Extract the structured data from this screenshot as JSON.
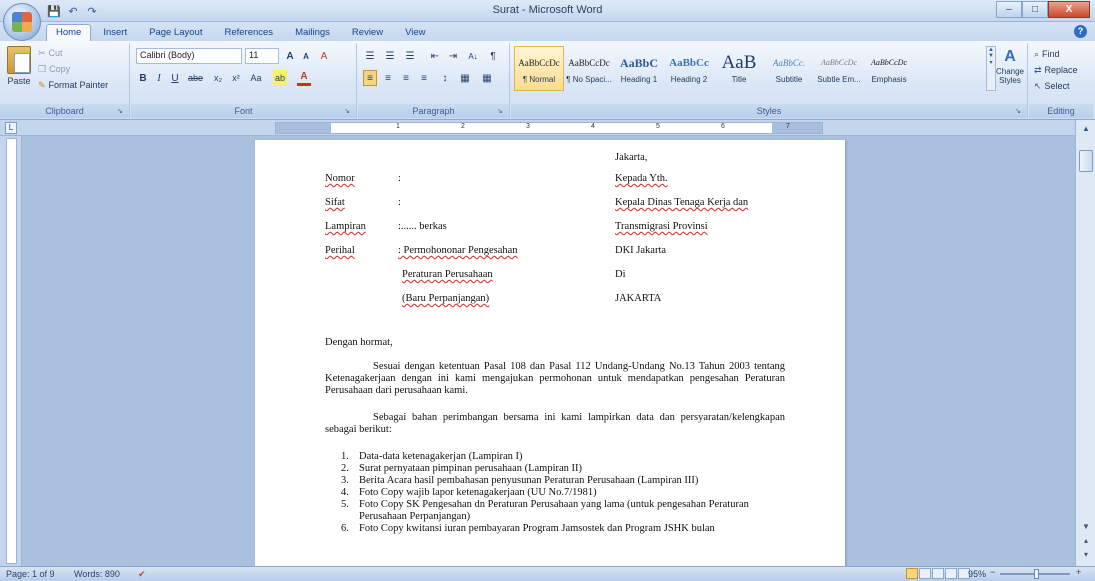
{
  "window": {
    "title": "Surat - Microsoft Word",
    "minimize": "–",
    "maximize": "□",
    "close": "X"
  },
  "qat": {
    "save": "💾",
    "undo": "↶",
    "redo": "↷"
  },
  "tabs": [
    "Home",
    "Insert",
    "Page Layout",
    "References",
    "Mailings",
    "Review",
    "View"
  ],
  "help": "?",
  "ribbon": {
    "clipboard": {
      "paste": "Paste",
      "cut": "Cut",
      "copy": "Copy",
      "format_painter": "Format Painter",
      "label": "Clipboard"
    },
    "font": {
      "name": "Calibri (Body)",
      "size": "11",
      "label": "Font",
      "grow": "A",
      "shrink": "A",
      "clear": "A",
      "bold": "B",
      "italic": "I",
      "underline": "U",
      "strike": "abe",
      "subscript": "x₂",
      "superscript": "x²",
      "change_case": "Aa",
      "highlight": "ab",
      "color": "A"
    },
    "paragraph": {
      "label": "Paragraph",
      "bullets": "☰",
      "numbering": "☰",
      "multilevel": "☰",
      "decrease_indent": "⇤",
      "increase_indent": "⇥",
      "sort": "A↓",
      "pilcrow": "¶",
      "align_left": "≡",
      "center": "≡",
      "align_right": "≡",
      "justify": "≡",
      "line_spacing": "↕",
      "shading": "▦",
      "borders": "▦"
    },
    "styles": {
      "label": "Styles",
      "items": [
        {
          "sample": "AaBbCcDc",
          "name": "¶ Normal"
        },
        {
          "sample": "AaBbCcDc",
          "name": "¶ No Spaci..."
        },
        {
          "sample": "AaBbC",
          "name": "Heading 1"
        },
        {
          "sample": "AaBbCc",
          "name": "Heading 2"
        },
        {
          "sample": "AaB",
          "name": "Title"
        },
        {
          "sample": "AaBbCc.",
          "name": "Subtitle"
        },
        {
          "sample": "AaBbCcDc",
          "name": "Subtle Em..."
        },
        {
          "sample": "AaBbCcDc",
          "name": "Emphasis"
        }
      ],
      "change_styles": "Change Styles"
    },
    "editing": {
      "label": "Editing",
      "find": "Find",
      "replace": "Replace",
      "select": "Select"
    }
  },
  "ruler": {
    "numbers": [
      "1",
      "2",
      "3",
      "4",
      "5",
      "6",
      "7"
    ]
  },
  "document": {
    "place": "Jakarta,",
    "header": [
      {
        "label": "Nomor",
        "colon": ":",
        "value": "",
        "right": "Kepada Yth."
      },
      {
        "label": "Sifat",
        "colon": ":",
        "value": "",
        "right": "Kepala Dinas Tenaga Kerja dan"
      },
      {
        "label": "Lampiran",
        "colon": "",
        "value": ":...... berkas",
        "right": "Transmigrasi Provinsi"
      },
      {
        "label": "Perihal",
        "colon": "",
        "value": ": Permohononar Pengesahan",
        "right": "DKI Jakarta"
      },
      {
        "label": "",
        "colon": "",
        "value": "Peraturan Perusahaan",
        "right": "Di"
      },
      {
        "label": "",
        "colon": "",
        "value": "(Baru Perpanjangan)",
        "right": "JAKARTA"
      }
    ],
    "greeting": "Dengan hormat,",
    "paragraph1": "Sesuai dengan ketentuan Pasal 108 dan Pasal 112 Undang-Undang No.13 Tahun 2003 tentang Ketenagakerjaan dengan ini kami mengajukan permohonan untuk mendapatkan pengesahan Peraturan Perusahaan dari perusahaan kami.",
    "paragraph2": "Sebagai bahan perimbangan bersama ini kami lampirkan data dan persyaratan/kelengkapan sebagai berikut:",
    "list": [
      {
        "num": "1.",
        "text": "Data-data ketenagakerjan (Lampiran I)"
      },
      {
        "num": "2.",
        "text": "Surat pernyataan pimpinan perusahaan (Lampiran II)"
      },
      {
        "num": "3.",
        "text": "Berita Acara hasil pembahasan penyusunan Peraturan Perusahaan (Lampiran III)"
      },
      {
        "num": "4.",
        "text": "Foto Copy wajib lapor ketenagakerjaan (UU No.7/1981)"
      },
      {
        "num": "5.",
        "text": "Foto Copy SK Pengesahan dn Peraturan Perusahaan yang lama (untuk pengesahan Peraturan Perusahaan Perpanjangan)"
      },
      {
        "num": "6.",
        "text": "Foto Copy kwitansi iuran pembayaran Program Jamsostek dan Program JSHK bulan"
      }
    ]
  },
  "status": {
    "page": "Page: 1 of 9",
    "words": "Words: 890",
    "zoom": "95%",
    "zoom_out": "−",
    "zoom_in": "+"
  }
}
